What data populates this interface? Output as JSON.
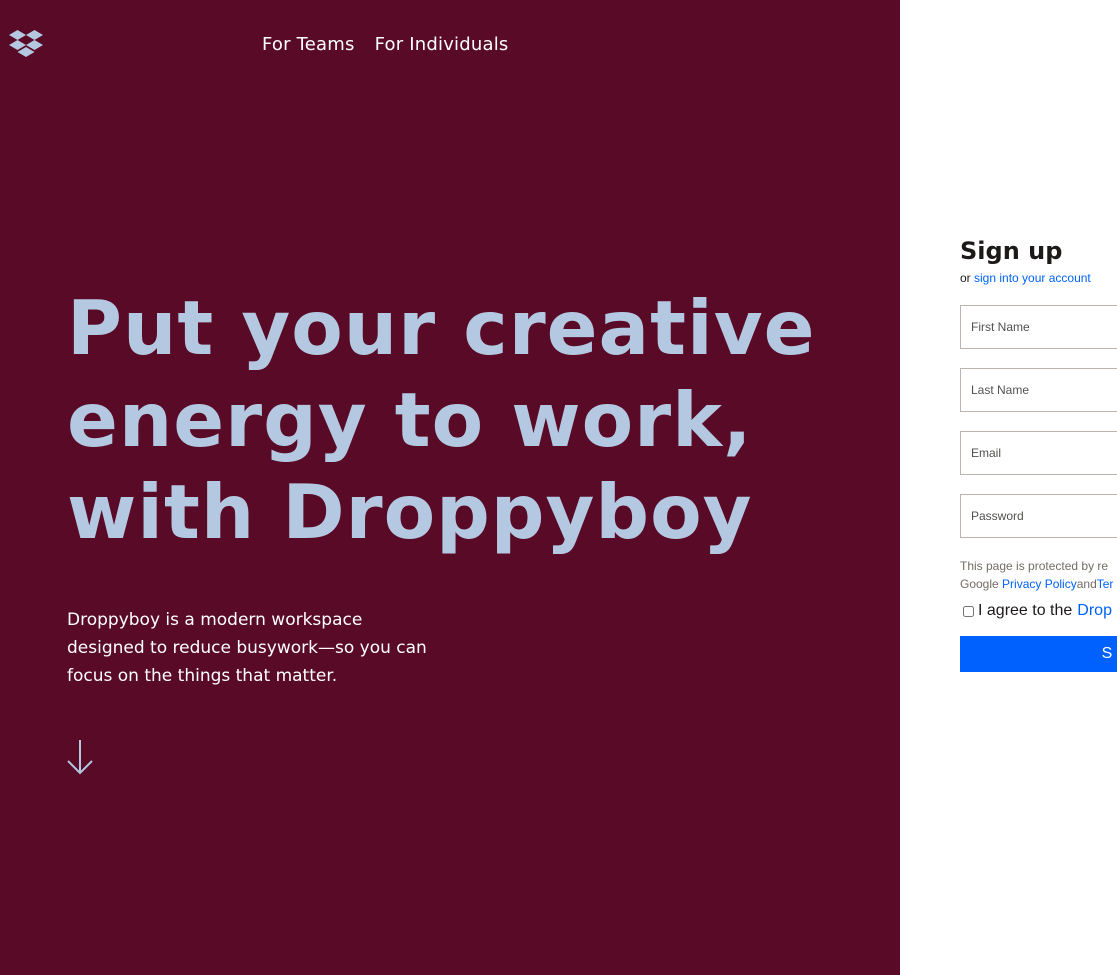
{
  "colors": {
    "hero_bg": "#580a26",
    "headline": "#b4c8e1",
    "accent": "#0061fe"
  },
  "header": {
    "logo_icon": "dropbox-logo-icon",
    "nav": [
      {
        "label": "For Teams"
      },
      {
        "label": "For Individuals"
      }
    ]
  },
  "hero": {
    "headline": "Put your creative energy to work, with Droppyboy",
    "subtitle": "Droppyboy is a modern workspace designed to reduce busywork—so you can focus on the things that matter.",
    "scroll_icon": "arrow-down-icon"
  },
  "signup": {
    "title": "Sign up",
    "or_text": "or",
    "signin_link": "sign into your account",
    "fields": {
      "first_name": {
        "placeholder": "First Name",
        "value": ""
      },
      "last_name": {
        "placeholder": "Last Name",
        "value": ""
      },
      "email": {
        "placeholder": "Email",
        "value": ""
      },
      "password": {
        "placeholder": "Password",
        "value": ""
      }
    },
    "recaptcha": {
      "line1": "This page is protected by re",
      "line2_prefix": "Google ",
      "privacy_link": "Privacy Policy",
      "and": "and",
      "terms_link": "Ter"
    },
    "agree": {
      "checked": false,
      "text": "I agree to the",
      "link": "Drop"
    },
    "submit_label": "S"
  }
}
